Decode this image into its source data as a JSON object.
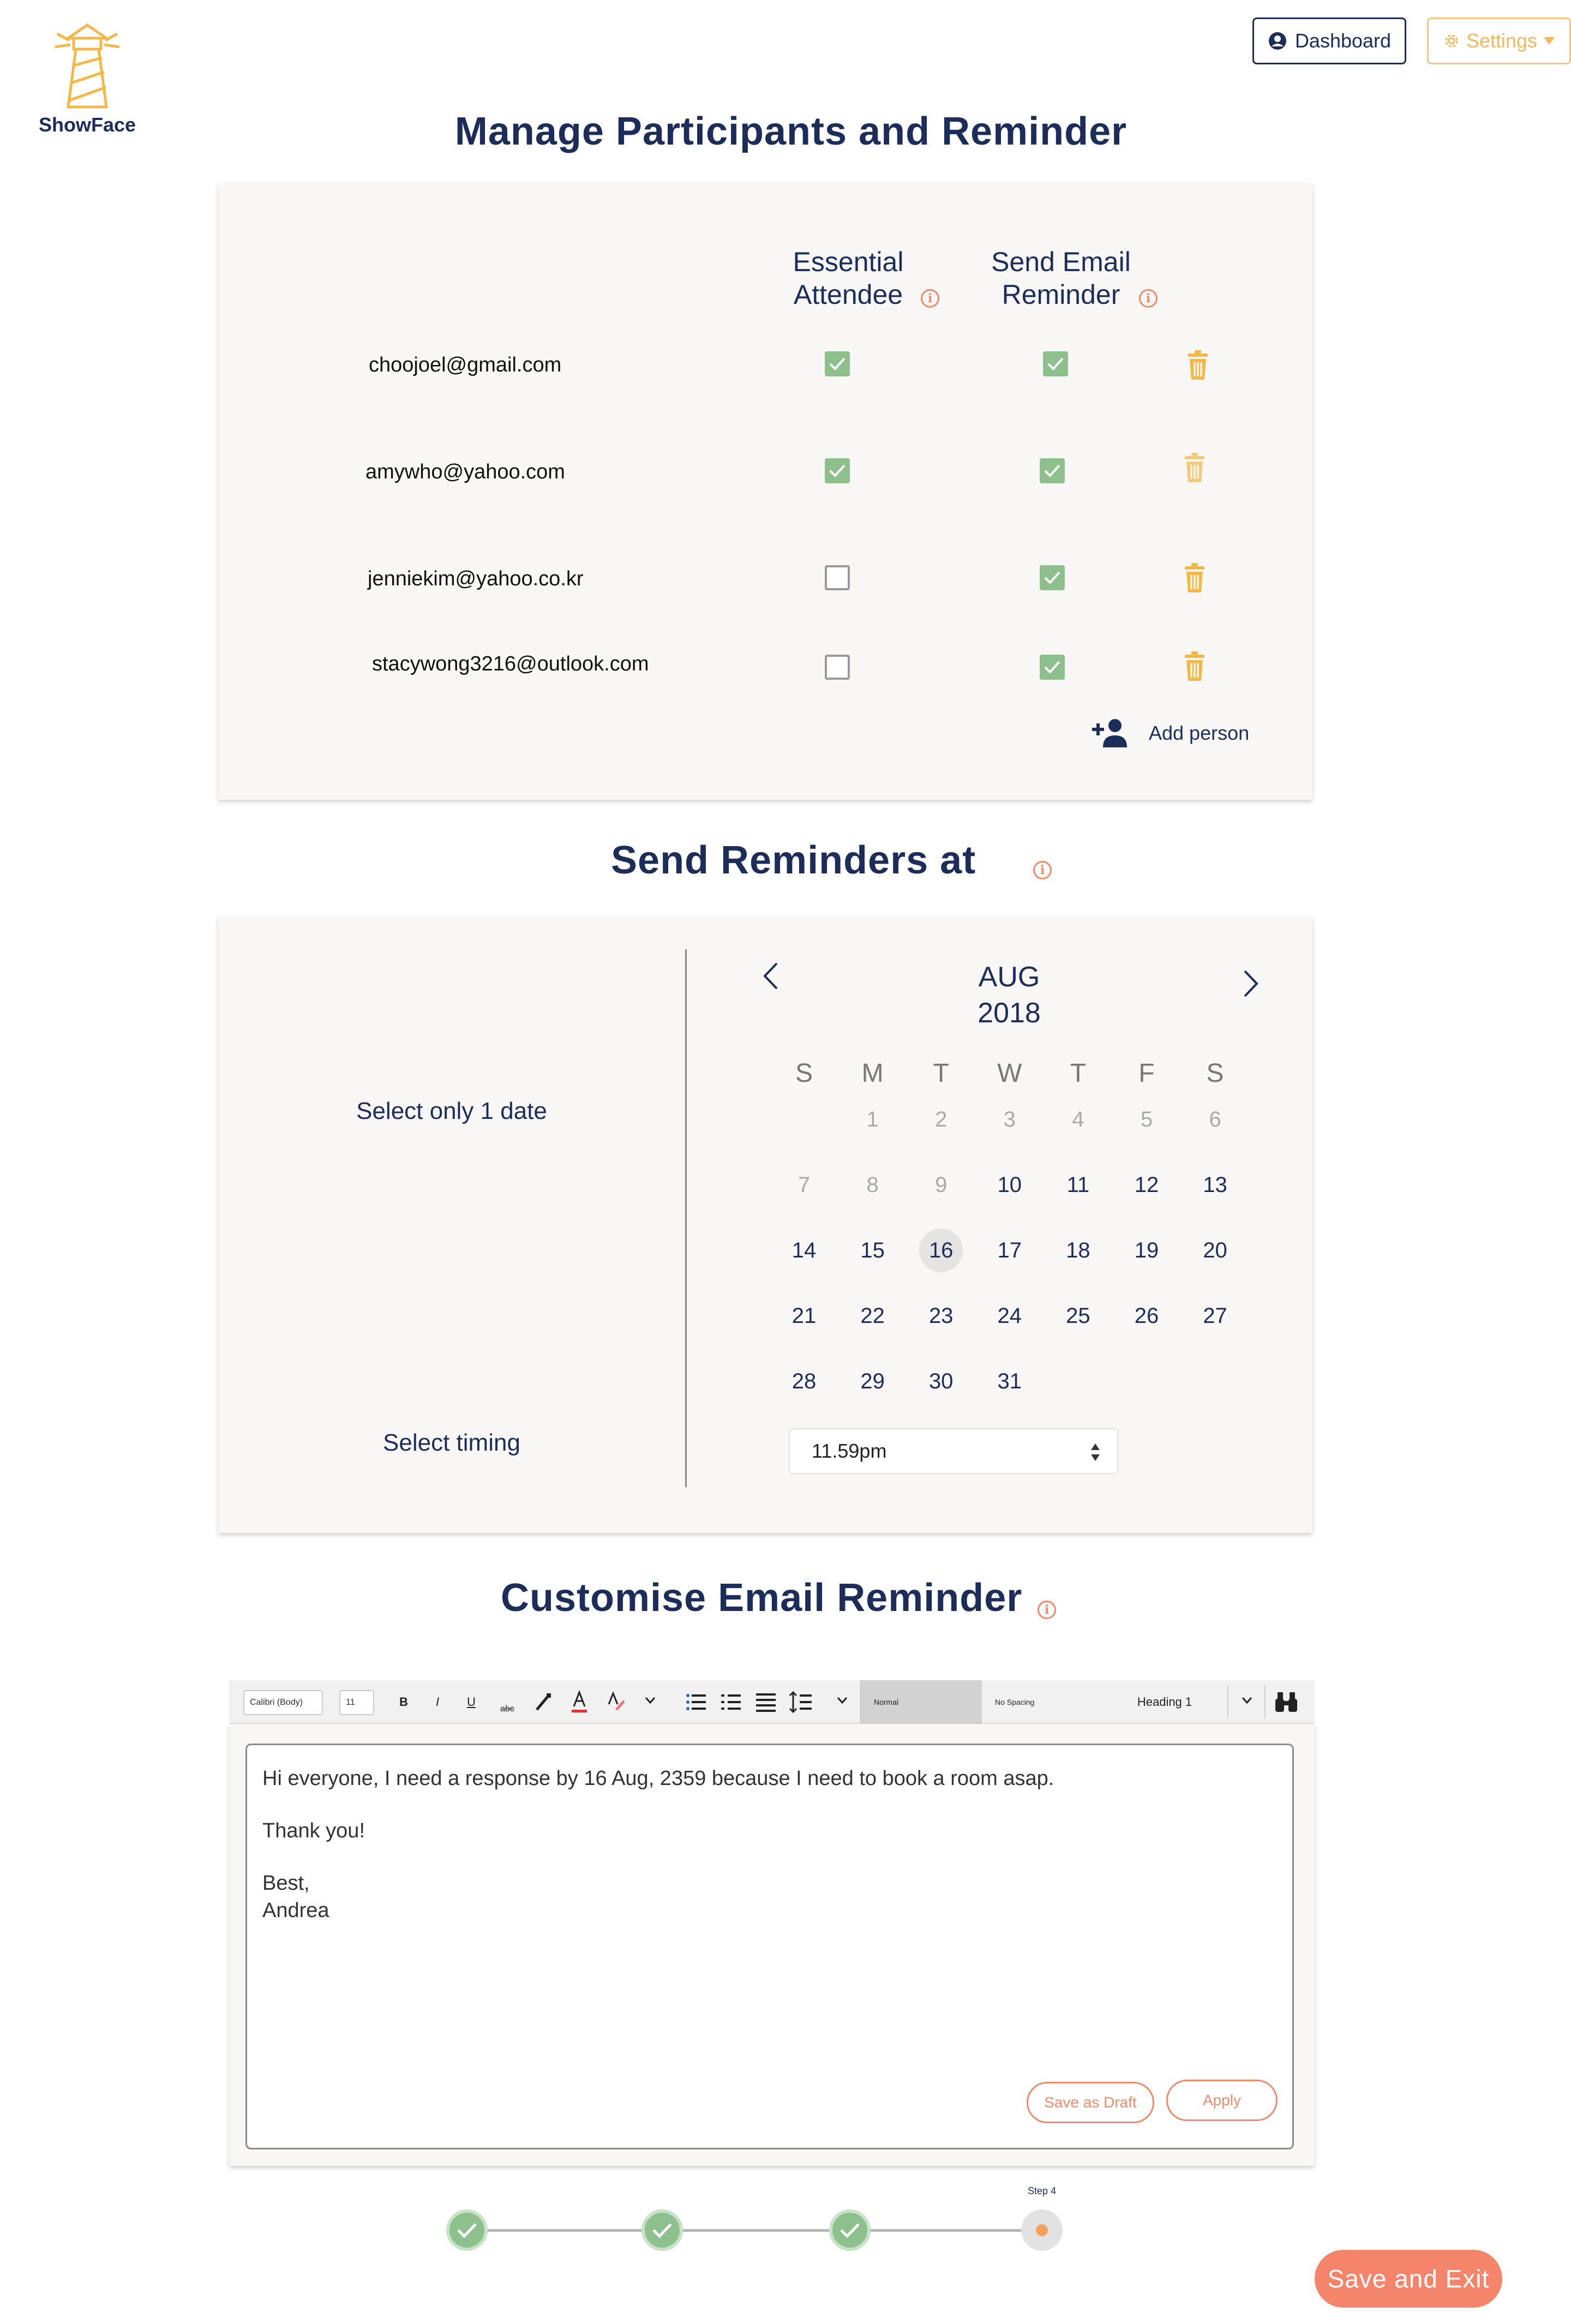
{
  "app": {
    "name": "ShowFace"
  },
  "header": {
    "dashboard_label": "Dashboard",
    "settings_label": "Settings"
  },
  "colors": {
    "navy": "#1c2d5a",
    "accent_yellow": "#f5c77e",
    "coral": "#f4846a",
    "check_green": "#8dc08c",
    "card_bg": "#f8f7f5"
  },
  "participants": {
    "title": "Manage Participants and Reminder",
    "col_essential_l1": "Essential",
    "col_essential_l2": "Attendee",
    "col_email_l1": "Send Email",
    "col_email_l2": "Reminder",
    "rows": [
      {
        "email": "choojoel@gmail.com",
        "essential": true,
        "reminder": true
      },
      {
        "email": "amywho@yahoo.com",
        "essential": true,
        "reminder": true
      },
      {
        "email": "jenniekim@yahoo.co.kr",
        "essential": false,
        "reminder": true
      },
      {
        "email": "stacywong3216@outlook.com",
        "essential": false,
        "reminder": true
      }
    ],
    "add_person_label": "Add person"
  },
  "reminders": {
    "title": "Send Reminders at",
    "select_date_label": "Select only 1 date",
    "select_timing_label": "Select timing",
    "month": "AUG",
    "year": "2018",
    "weekdays": [
      "S",
      "M",
      "T",
      "W",
      "T",
      "F",
      "S"
    ],
    "weeks": [
      [
        "",
        "1",
        "2",
        "3",
        "4",
        "5",
        "6"
      ],
      [
        "7",
        "8",
        "9",
        "10",
        "11",
        "12",
        "13"
      ],
      [
        "14",
        "15",
        "16",
        "17",
        "18",
        "19",
        "20"
      ],
      [
        "21",
        "22",
        "23",
        "24",
        "25",
        "26",
        "27"
      ],
      [
        "28",
        "29",
        "30",
        "31",
        "",
        "",
        ""
      ]
    ],
    "selected_day": "16",
    "timing_value": "11.59pm"
  },
  "email_reminder": {
    "title": "Customise Email Reminder",
    "toolbar": {
      "font_name": "Calibri (Body)",
      "font_size": "11",
      "bold": "B",
      "italic": "I",
      "underline": "U",
      "strike": "abc",
      "style_normal": "Normal",
      "style_no_spacing": "No Spacing",
      "style_heading": "Heading 1"
    },
    "body_line1": "Hi everyone, I need a response by 16 Aug, 2359 because I need to book a room asap.",
    "body_line2": "Thank you!",
    "body_line3": "Best,",
    "body_line4": "Andrea",
    "save_draft_label": "Save as Draft",
    "apply_label": "Apply"
  },
  "progress": {
    "current_step_label": "Step 4"
  },
  "footer": {
    "save_exit_label": "Save and Exit"
  }
}
